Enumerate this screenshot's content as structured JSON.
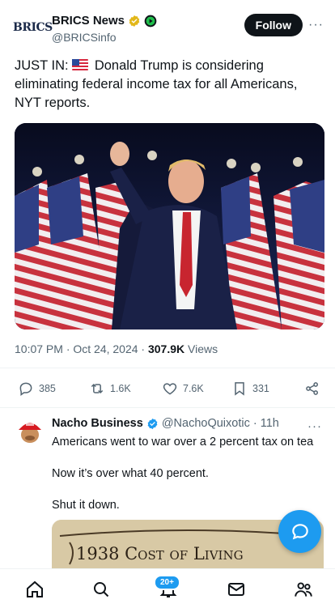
{
  "post": {
    "author_name": "BRICS News",
    "author_handle": "@BRICSinfo",
    "logo_text": "BRICS",
    "follow_label": "Follow",
    "more_label": "···",
    "text_prefix": "JUST IN:",
    "text_body": "Donald Trump is considering eliminating federal income tax for all Americans, NYT reports.",
    "timestamp": "10:07 PM · Oct 24, 2024 · ",
    "views_count": "307.9K",
    "views_label": " Views",
    "image_icon": "photo-of-man-with-raised-fist-in-front-of-flags"
  },
  "actions": {
    "replies": "385",
    "reposts": "1.6K",
    "likes": "7.6K",
    "bookmarks": "331"
  },
  "reply": {
    "author_name": "Nacho Business",
    "author_handle": "@NachoQuixotic",
    "time": "· 11h",
    "more_label": "···",
    "lines": [
      "Americans went to war over a 2 percent tax on tea",
      "Now it’s over what 40 percent.",
      "Shut it down."
    ],
    "image_text": "1938 Cost of Living"
  },
  "nav": {
    "notifications_badge": "20+"
  },
  "colors": {
    "accent": "#1d9bf0",
    "verified_gold": "#e2b719",
    "text_secondary": "#536471"
  }
}
